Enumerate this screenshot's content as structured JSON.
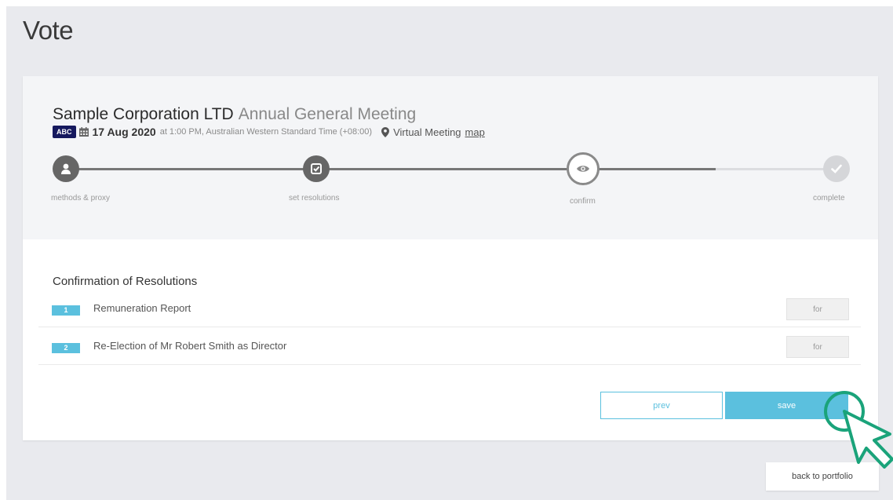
{
  "page": {
    "title": "Vote"
  },
  "meeting": {
    "company": "Sample Corporation LTD",
    "type": "Annual General Meeting",
    "code_badge": "ABC",
    "date": "17 Aug 2020",
    "time": "at 1:00 PM, Australian Western Standard Time (+08:00)",
    "venue": "Virtual Meeting",
    "map_link": "map"
  },
  "stepper": {
    "current_step": 3,
    "steps": [
      {
        "label": "methods & proxy",
        "icon": "user-icon",
        "state": "done"
      },
      {
        "label": "set resolutions",
        "icon": "check-square-icon",
        "state": "done"
      },
      {
        "label": "confirm",
        "icon": "eye-icon",
        "state": "current"
      },
      {
        "label": "complete",
        "icon": "check-icon",
        "state": "todo"
      }
    ]
  },
  "resolutions": {
    "title": "Confirmation of Resolutions",
    "items": [
      {
        "number": "1",
        "text": "Remuneration Report",
        "vote": "for"
      },
      {
        "number": "2",
        "text": "Re-Election of Mr Robert Smith as Director",
        "vote": "for"
      }
    ]
  },
  "actions": {
    "prev_label": "prev",
    "save_label": "save",
    "back_label": "back to portfolio"
  },
  "colors": {
    "accent": "#5bc0de",
    "badge": "#16195e",
    "cursor": "#1aa37a"
  }
}
